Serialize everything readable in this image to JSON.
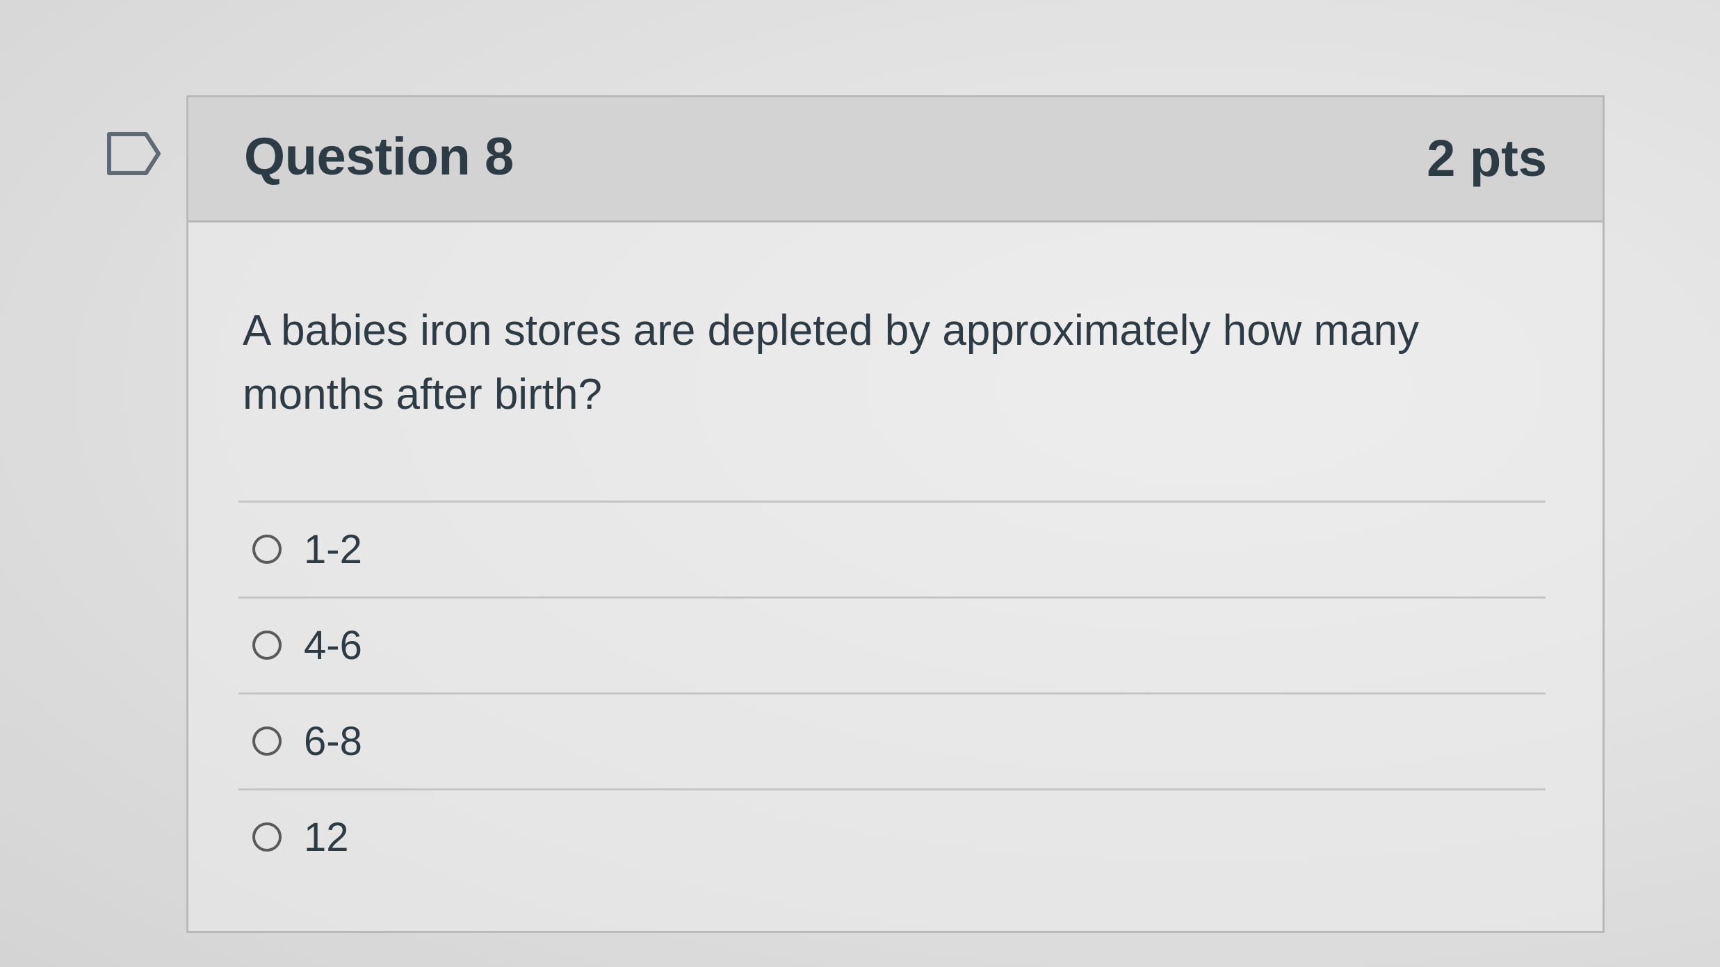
{
  "question": {
    "title": "Question 8",
    "points": "2 pts",
    "text": "A babies iron stores are depleted by approximately how many months after birth?",
    "answers": [
      {
        "label": "1-2",
        "selected": false
      },
      {
        "label": "4-6",
        "selected": false
      },
      {
        "label": "6-8",
        "selected": false
      },
      {
        "label": "12",
        "selected": false
      }
    ]
  },
  "icons": {
    "flag": "flag-question-icon",
    "radio": "radio-unselected-icon"
  }
}
